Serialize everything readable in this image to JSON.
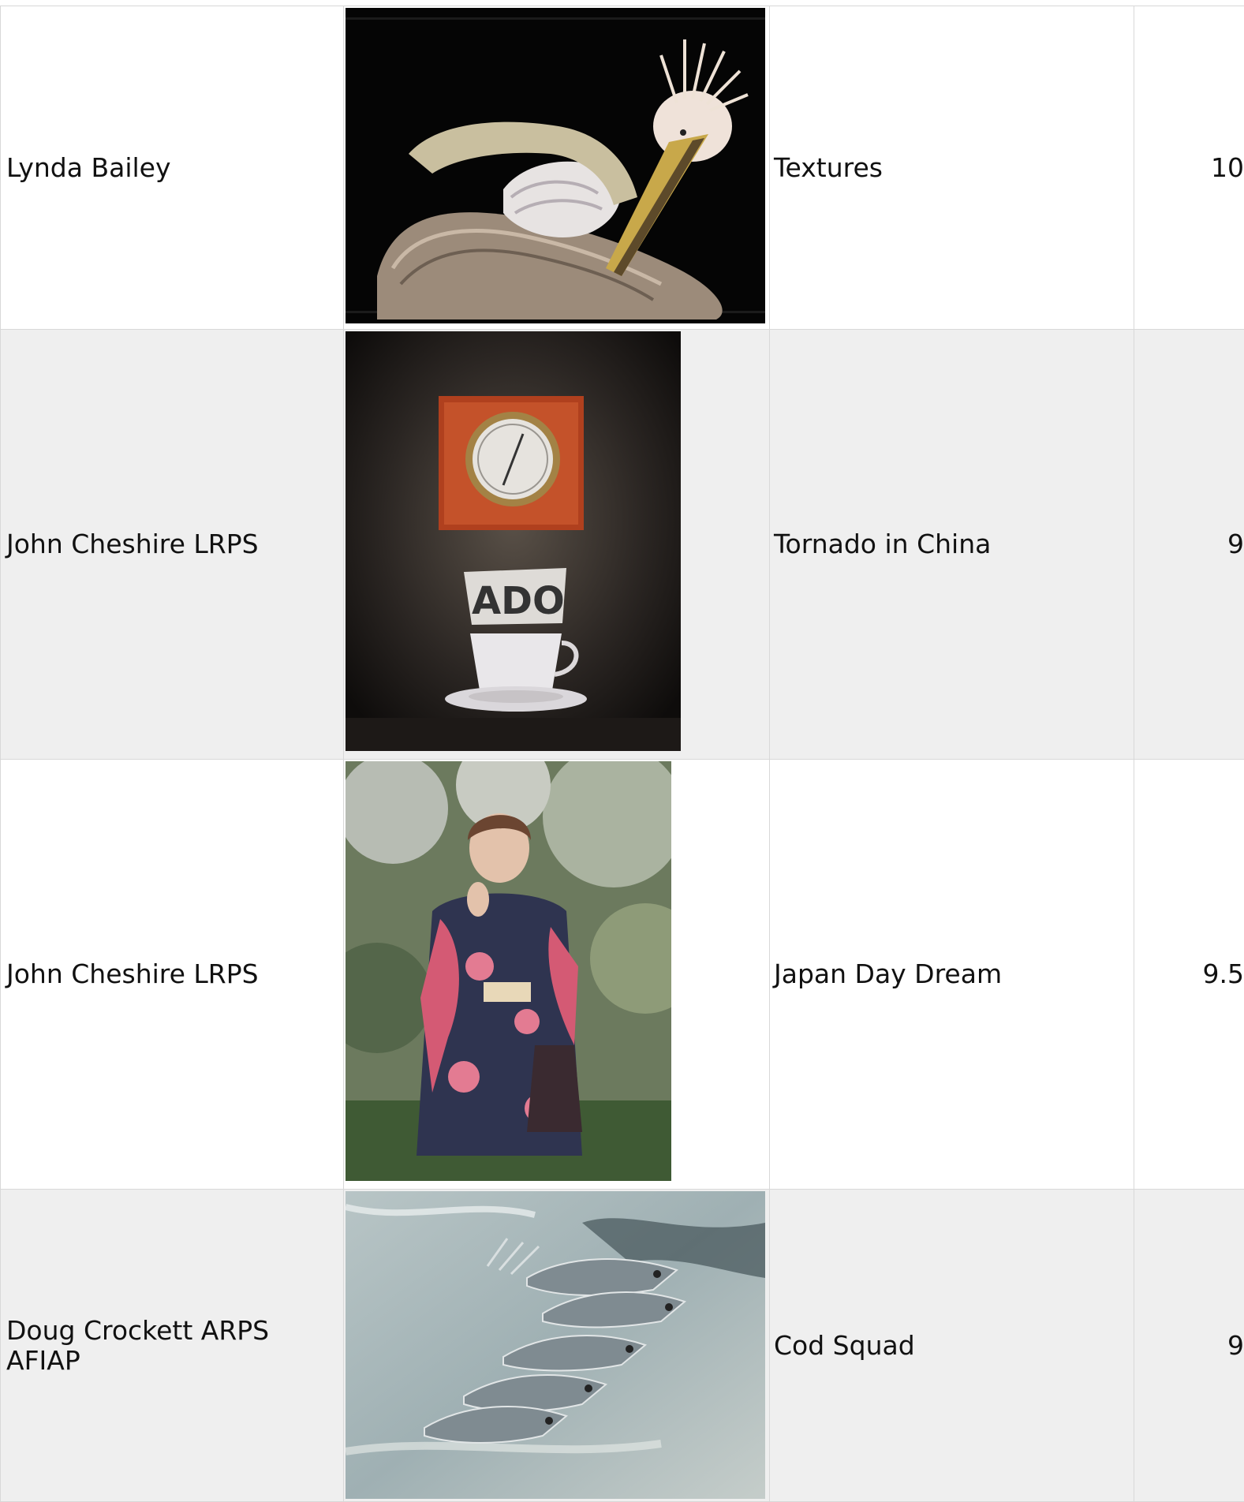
{
  "entries": [
    {
      "author": "Lynda Bailey",
      "title": "Textures",
      "score": "10",
      "image_icon": "pelican-photo"
    },
    {
      "author": "John Cheshire LRPS",
      "title": "Tornado in China",
      "score": "9",
      "image_icon": "barometer-teacup-photo",
      "image_text": "ADO"
    },
    {
      "author": "John Cheshire LRPS",
      "title": "Japan Day Dream",
      "score": "9.5",
      "image_icon": "kimono-woman-photo"
    },
    {
      "author": "Doug Crockett ARPS AFIAP",
      "title": "Cod Squad",
      "score": "9",
      "image_icon": "fish-photo"
    }
  ],
  "colors": {
    "row_plain": "#ffffff",
    "row_alt": "#efefef",
    "border": "#d8d8d8"
  }
}
